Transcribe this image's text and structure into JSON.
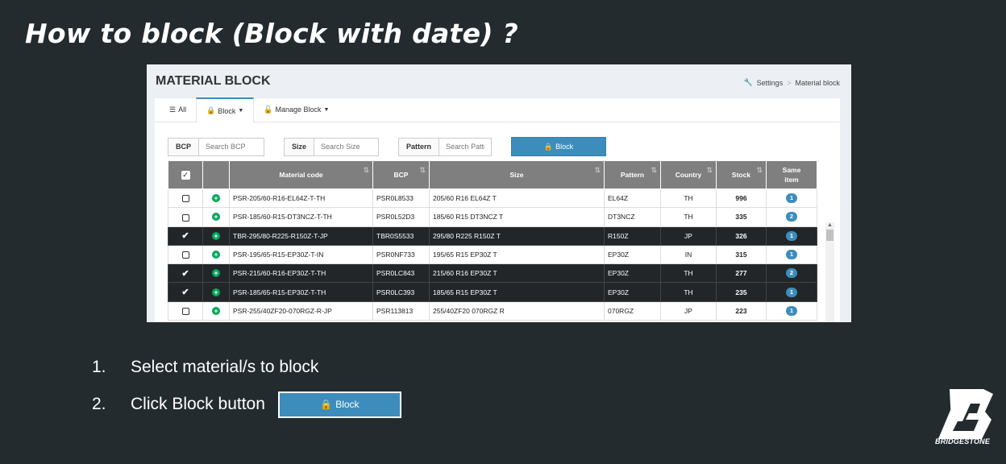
{
  "slide_title": "How to block (Block with date) ?",
  "header": {
    "page_title": "MATERIAL BLOCK",
    "breadcrumb": [
      "Settings",
      "Material block"
    ]
  },
  "tabs": [
    {
      "label": "All",
      "icon": "list-icon"
    },
    {
      "label": "Block",
      "icon": "lock-icon"
    },
    {
      "label": "Manage Block",
      "icon": "unlock-icon"
    }
  ],
  "filters": {
    "bcp": {
      "label": "BCP",
      "placeholder": "Search BCP"
    },
    "size": {
      "label": "Size",
      "placeholder": "Search Size"
    },
    "pattern": {
      "label": "Pattern",
      "placeholder": "Search Patte"
    },
    "block_button": "Block"
  },
  "table": {
    "headers": [
      "Material code",
      "BCP",
      "Size",
      "Pattern",
      "Country",
      "Stock",
      "Same item"
    ],
    "rows": [
      {
        "checked": false,
        "material": "PSR-205/60-R16-EL64Z-T-TH",
        "bcp": "PSR0L8533",
        "size": "205/60 R16 EL64Z T",
        "pattern": "EL64Z",
        "country": "TH",
        "stock": "996",
        "same": "1"
      },
      {
        "checked": false,
        "material": "PSR-185/60-R15-DT3NCZ-T-TH",
        "bcp": "PSR0L52D3",
        "size": "185/60 R15 DT3NCZ T",
        "pattern": "DT3NCZ",
        "country": "TH",
        "stock": "335",
        "same": "2"
      },
      {
        "checked": true,
        "material": "TBR-295/80-R225-R150Z-T-JP",
        "bcp": "TBR0S5533",
        "size": "295/80 R225 R150Z T",
        "pattern": "R150Z",
        "country": "JP",
        "stock": "326",
        "same": "1"
      },
      {
        "checked": false,
        "material": "PSR-195/65-R15-EP30Z-T-IN",
        "bcp": "PSR0NF733",
        "size": "195/65 R15 EP30Z T",
        "pattern": "EP30Z",
        "country": "IN",
        "stock": "315",
        "same": "1"
      },
      {
        "checked": true,
        "material": "PSR-215/60-R16-EP30Z-T-TH",
        "bcp": "PSR0LC843",
        "size": "215/60 R16 EP30Z T",
        "pattern": "EP30Z",
        "country": "TH",
        "stock": "277",
        "same": "2"
      },
      {
        "checked": true,
        "material": "PSR-185/65-R15-EP30Z-T-TH",
        "bcp": "PSR0LC393",
        "size": "185/65 R15 EP30Z T",
        "pattern": "EP30Z",
        "country": "TH",
        "stock": "235",
        "same": "1"
      },
      {
        "checked": false,
        "material": "PSR-255/40ZF20-070RGZ-R-JP",
        "bcp": "PSR113813",
        "size": "255/40ZF20 070RGZ R",
        "pattern": "070RGZ",
        "country": "JP",
        "stock": "223",
        "same": "1"
      }
    ]
  },
  "steps": [
    {
      "num": "1.",
      "text": "Select material/s to block"
    },
    {
      "num": "2.",
      "text": "Click Block button"
    }
  ],
  "step_button": "Block",
  "logo_text": "BRIDGESTONE",
  "colors": {
    "accent": "#3c8dbc",
    "background": "#232b2f",
    "selected_row": "#222629",
    "plus": "#00a65a"
  }
}
